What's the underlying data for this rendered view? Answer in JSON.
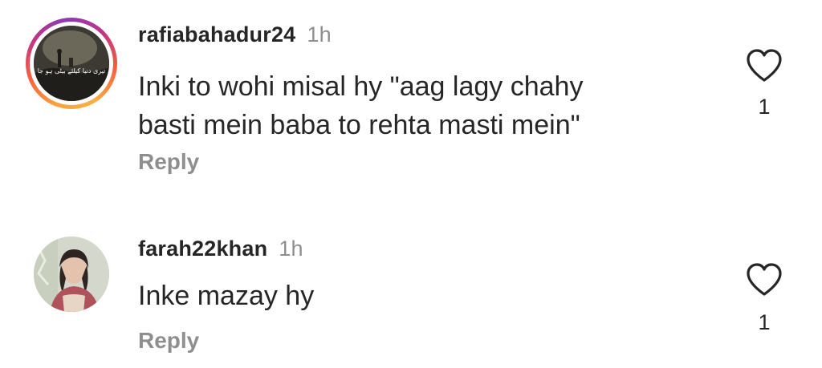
{
  "comments": [
    {
      "username": "rafiabahadur24",
      "time": "1h",
      "text_lines": [
        "Inki to wohi misal hy \"aag lagy chahy",
        "basti mein baba to rehta masti mein\""
      ],
      "reply_label": "Reply",
      "like_count": "1",
      "avatar_caption": "تیری دنیا کیلئے بیٹی ہو جا"
    },
    {
      "username": "farah22khan",
      "time": "1h",
      "text_lines": [
        "Inke mazay hy"
      ],
      "reply_label": "Reply",
      "like_count": "1"
    }
  ],
  "icons": {
    "like": "heart-outline-icon"
  },
  "colors": {
    "text_primary": "#262626",
    "text_secondary": "#8e8e8e",
    "background": "#ffffff"
  }
}
